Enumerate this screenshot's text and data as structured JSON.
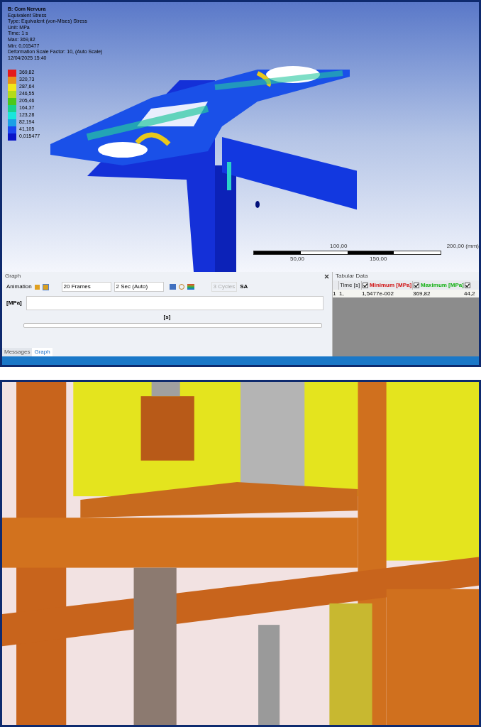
{
  "result": {
    "title": "B: Com Nervura",
    "lines": [
      "Equivalent Stress",
      "Type: Equivalent (von-Mises) Stress",
      "Unit: MPa",
      "Time: 1 s",
      "Max: 369,82",
      "Min: 0,015477",
      "Deformation Scale Factor: 10, (Auto Scale)",
      "12/04/2025 15:40"
    ]
  },
  "legend": [
    {
      "value": "369,82",
      "color": "#e41a1a"
    },
    {
      "value": "320,73",
      "color": "#e8901a"
    },
    {
      "value": "287,64",
      "color": "#f0e61a"
    },
    {
      "value": "246,55",
      "color": "#b4dc1a"
    },
    {
      "value": "205,46",
      "color": "#4cc81a"
    },
    {
      "value": "164,37",
      "color": "#1ad28c"
    },
    {
      "value": "123,28",
      "color": "#1ae6dc"
    },
    {
      "value": "82,194",
      "color": "#1aa0e6"
    },
    {
      "value": "41,105",
      "color": "#1a46f0"
    },
    {
      "value": "0,015477",
      "color": "#0a14c8"
    }
  ],
  "scale_bar": {
    "top_labels": [
      "100,00",
      "200,00 (mm)"
    ],
    "bottom_labels": [
      "50,00",
      "150,00"
    ]
  },
  "graph": {
    "title": "Graph",
    "toolbar": {
      "label": "Animation",
      "frames": "20 Frames",
      "duration": "2 Sec (Auto)",
      "cycles": {
        "label": "3 Cycles",
        "disabled": true
      },
      "sa": "SA"
    },
    "y_axis": "[MPa]",
    "x_axis": "[s]",
    "tabs": [
      {
        "label": "Messages",
        "selected": false
      },
      {
        "label": "Graph",
        "selected": true
      }
    ]
  },
  "tabular": {
    "title": "Tabular Data",
    "columns": [
      {
        "label": "Time [s]"
      },
      {
        "label": "Minimum [MPa]",
        "checked": true,
        "color": "#d01010"
      },
      {
        "label": "Maximum [MPa]",
        "checked": true,
        "color": "#10b010"
      },
      {
        "checked": true
      }
    ],
    "rows": [
      {
        "number": "1",
        "cells": [
          "1,",
          "1,5477e-002",
          "369,82",
          "44,2"
        ]
      }
    ]
  }
}
